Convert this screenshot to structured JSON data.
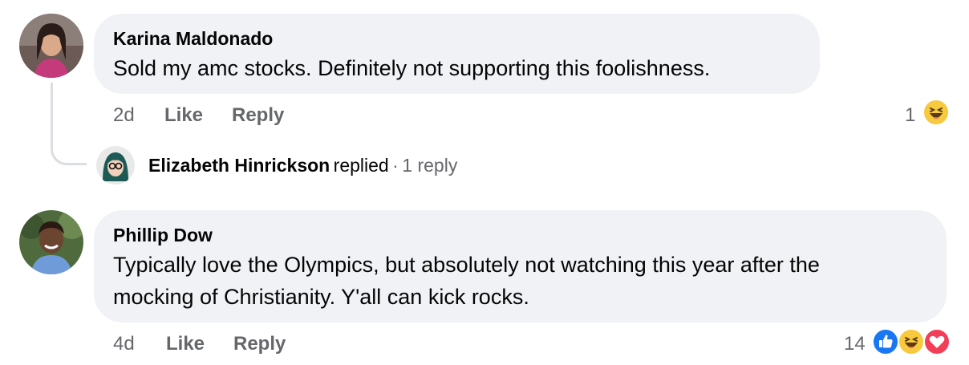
{
  "comments": [
    {
      "author": "Karina Maldonado",
      "text_lines": [
        "Sold my amc stocks. Definitely not supporting this foolishness."
      ],
      "age": "2d",
      "like_label": "Like",
      "reply_label": "Reply",
      "reaction_count": "1",
      "reactions": [
        "haha-emoji-icon"
      ],
      "reply_summary": {
        "author": "Elizabeth Hinrickson",
        "verb": "replied",
        "separator": "·",
        "count_text": "1 reply"
      }
    },
    {
      "author": "Phillip Dow",
      "text_lines": [
        "Typically love the Olympics, but absolutely not watching this year after the",
        "mocking of Christianity. Y'all can kick rocks."
      ],
      "age": "4d",
      "like_label": "Like",
      "reply_label": "Reply",
      "reaction_count": "14",
      "reactions": [
        "like-emoji-icon",
        "haha-emoji-icon",
        "love-emoji-icon"
      ]
    }
  ],
  "colors": {
    "bubble": "#f0f2f5",
    "meta": "#65676b",
    "text": "#050505",
    "like_blue": "#1877f2",
    "love_red": "#f33e58",
    "haha_yellow": "#f7c93e"
  }
}
